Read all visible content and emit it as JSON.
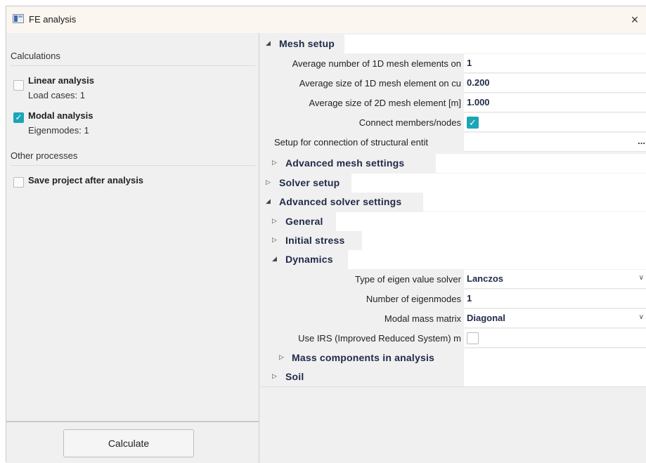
{
  "window": {
    "title": "FE analysis",
    "close": "×"
  },
  "left": {
    "calculations_title": "Calculations",
    "linear": {
      "label": "Linear analysis",
      "sub": "Load cases: 1",
      "checked": false
    },
    "modal": {
      "label": "Modal analysis",
      "sub": "Eigenmodes: 1",
      "checked": true
    },
    "other_title": "Other processes",
    "save": {
      "label": "Save project after analysis",
      "checked": false
    },
    "calculate": "Calculate"
  },
  "props": {
    "mesh_setup": "Mesh setup",
    "avg_1d_label": "Average number of 1D mesh elements on",
    "avg_1d_value": "1",
    "avg_1d_size_label": "Average size of 1D mesh element on cu",
    "avg_1d_size_value": "0.200",
    "avg_2d_label": "Average size of 2D mesh element [m]",
    "avg_2d_value": "1.000",
    "connect_label": "Connect members/nodes",
    "connect_checked": true,
    "setup_conn_label": "Setup for connection of structural entit",
    "setup_conn_ellipsis": "...",
    "advanced_mesh": "Advanced mesh settings",
    "solver_setup": "Solver setup",
    "advanced_solver": "Advanced solver settings",
    "general": "General",
    "initial_stress": "Initial stress",
    "dynamics": "Dynamics",
    "eigen_solver_label": "Type of eigen value solver",
    "eigen_solver_value": "Lanczos",
    "num_eigen_label": "Number of eigenmodes",
    "num_eigen_value": "1",
    "modal_mass_label": "Modal mass matrix",
    "modal_mass_value": "Diagonal",
    "irs_label": "Use IRS (Improved Reduced System) m",
    "irs_checked": false,
    "mass_components": "Mass components in analysis",
    "soil": "Soil"
  },
  "glyphs": {
    "expanded": "◢",
    "collapsed": "▷",
    "dropdown": "∨",
    "check": "✓"
  },
  "colors": {
    "accent": "#1aa6b7",
    "heading": "#1f2a48"
  }
}
